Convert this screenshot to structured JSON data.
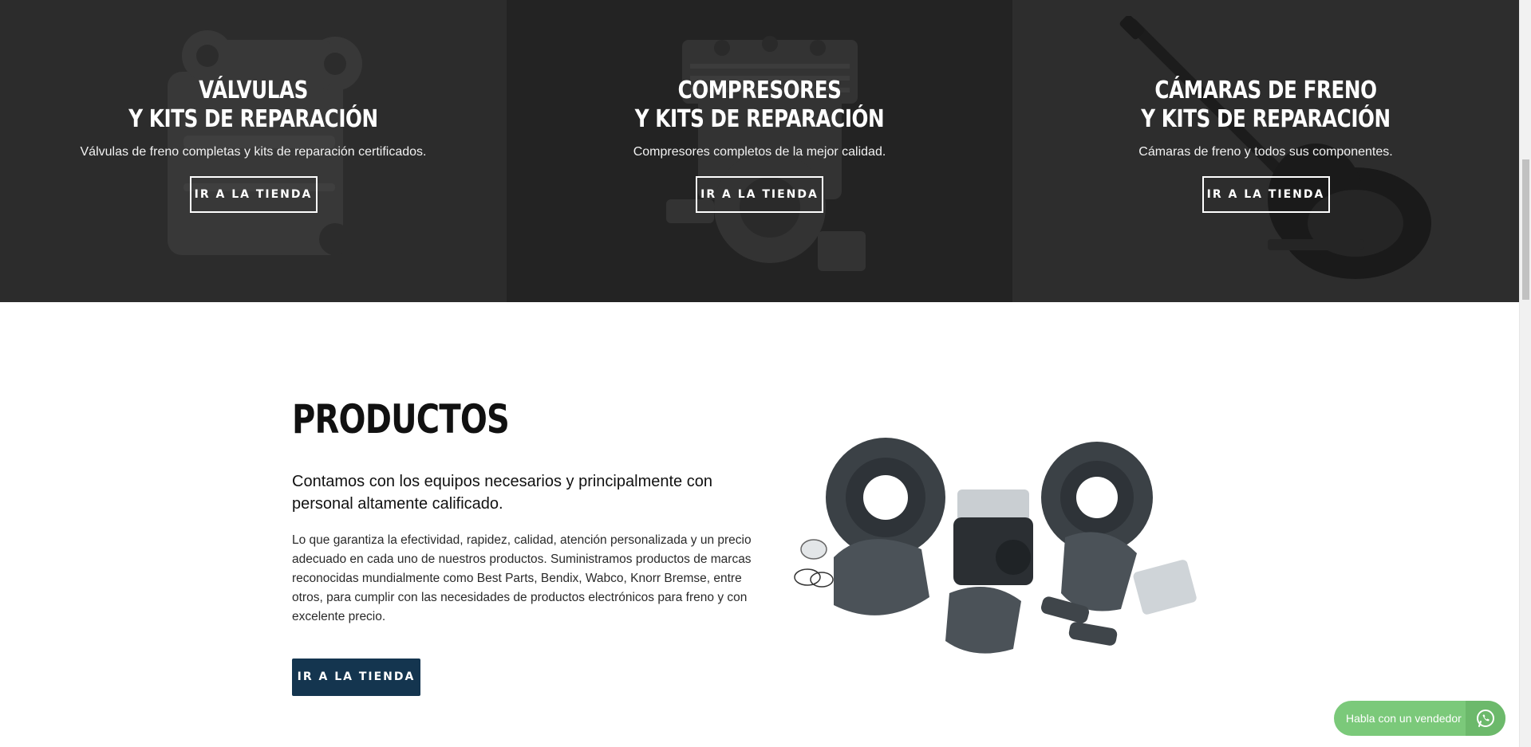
{
  "categories": [
    {
      "title_line1": "VÁLVULAS",
      "title_line2": "Y KITS DE REPARACIÓN",
      "description": "Válvulas de freno completas y kits de reparación certificados.",
      "button_label": "IR A LA TIENDA",
      "image_icon": "valve-icon"
    },
    {
      "title_line1": "COMPRESORES",
      "title_line2": "Y KITS DE REPARACIÓN",
      "description": "Compresores completos de la mejor calidad.",
      "button_label": "IR A LA TIENDA",
      "image_icon": "compressor-icon"
    },
    {
      "title_line1": "CÁMARAS DE FRENO",
      "title_line2": "Y KITS DE REPARACIÓN",
      "description": "Cámaras de freno y todos sus componentes.",
      "button_label": "IR A LA TIENDA",
      "image_icon": "brake-chamber-icon"
    }
  ],
  "products": {
    "title": "PRODUCTOS",
    "lead": "Contamos con los equipos necesarios y principalmente con personal altamente calificado.",
    "body": "Lo que garantiza la efectividad, rapidez, calidad, atención personalizada y un precio adecuado en cada uno de nuestros productos. Suministramos productos de marcas reconocidas mundialmente como Best Parts, Bendix, Wabco, Knorr Bremse, entre otros, para cumplir con las necesidades de productos electrónicos para freno y con excelente precio.",
    "button_label": "IR A LA TIENDA",
    "image_icon": "brake-parts-image"
  },
  "chat": {
    "label": "Habla con un vendedor",
    "icon": "whatsapp-icon"
  },
  "colors": {
    "button_navy": "#14354f",
    "chat_green": "#7bc97a",
    "banner_dark": "#2c2c2c"
  }
}
